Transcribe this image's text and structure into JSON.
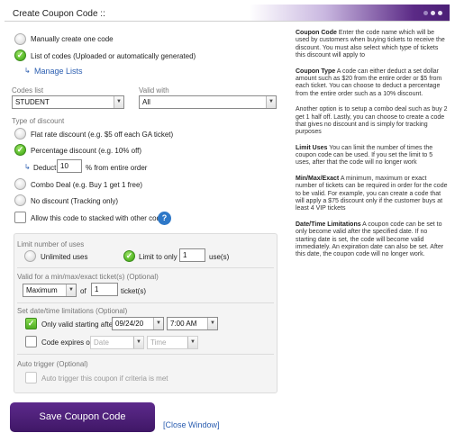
{
  "window": {
    "title": "Create Coupon Code ::"
  },
  "code_source": {
    "manual_label": "Manually create one code",
    "list_label": "List of codes (Uploaded or automatically generated)",
    "manage_lists_label": "Manage Lists"
  },
  "codes_list": {
    "label": "Codes list",
    "value": "STUDENT"
  },
  "valid_with": {
    "label": "Valid with",
    "value": "All"
  },
  "discount": {
    "section_label": "Type of discount",
    "flat_label": "Flat rate discount (e.g. $5 off each GA ticket)",
    "percentage_label": "Percentage discount (e.g. 10% off)",
    "deduct_prefix": "Deduct",
    "deduct_value": "10",
    "deduct_suffix": "% from entire order",
    "combo_label": "Combo Deal (e.g. Buy 1 get 1 free)",
    "none_label": "No discount (Tracking only)",
    "stack_label": "Allow this code to stacked with other codes",
    "help_icon": "?"
  },
  "limits": {
    "section_label": "Limit number of uses",
    "unlimited_label": "Unlimited uses",
    "limit_to_label": "Limit to only",
    "limit_value": "1",
    "uses_suffix": "use(s)",
    "min_max_label": "Valid for a min/max/exact ticket(s) (Optional)",
    "min_max_value": "Maximum",
    "of_label": "of",
    "tickets_value": "1",
    "tickets_suffix": "ticket(s)",
    "date_section_label": "Set date/time limitations (Optional)",
    "valid_start_label": "Only valid starting after",
    "start_date": "09/24/20",
    "start_time": "7:00 AM",
    "expires_label": "Code expires on",
    "expire_date_placeholder": "Date",
    "expire_time_placeholder": "Time",
    "auto_section_label": "Auto trigger (Optional)",
    "auto_label": "Auto trigger this coupon if criteria is met"
  },
  "actions": {
    "save_label": "Save Coupon Code",
    "close_label": "[Close Window]"
  },
  "help_text": [
    {
      "title": "Coupon Code",
      "body": "Enter the code name which will be used by customers when buying tickets to receive the discount. You must also select which type of tickets this discount will apply to"
    },
    {
      "title": "Coupon Type",
      "body": "A code can either deduct a set dollar amount such as $20 from the entire order or $5 from each ticket. You can choose to deduct a percentage from the entire order such as a 10% discount."
    },
    {
      "title": "",
      "body": "Another option is to setup a combo deal such as buy 2 get 1 half off. Lastly, you can choose to create a code that gives no discount and is simply for tracking purposes"
    },
    {
      "title": "Limit Uses",
      "body": "You can limit the number of times the coupon code can be used. If you set the limit to 5 uses, after that the code will no longer work"
    },
    {
      "title": "Min/Max/Exact",
      "body": "A minimum, maximum or exact number of tickets can be required in order for the code to be valid. For example, you can create a code that will apply a $75 discount only if the customer buys at least 4 VIP tickets"
    },
    {
      "title": "Date/Time Limitations",
      "body": "A coupon code can be set to only become valid after the specified date. If no starting date is set, the code will become valid immediately. An expiration date can also be set. After this date, the coupon code will no longer work."
    }
  ],
  "colors": {
    "accent_purple": "#4b1f76",
    "check_green": "#5bbd2b",
    "link_blue": "#2a5db0"
  }
}
